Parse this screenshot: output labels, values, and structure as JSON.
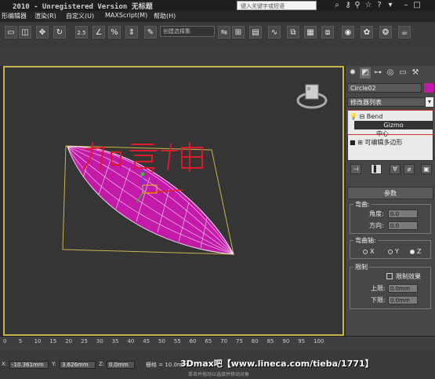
{
  "titlebar": {
    "title": "2010 - Unregistered Version  无标题",
    "search_placeholder": "键入关键字或短语",
    "icons": [
      "binoculars-icon",
      "star-icon",
      "key-icon",
      "question-icon",
      "minimize-icon",
      "maximize-icon"
    ]
  },
  "menu": {
    "items": [
      "形编辑器",
      "渲染(R)",
      "自定义(U)",
      "MAXScript(M)",
      "帮助(H)"
    ]
  },
  "toolbar": {
    "selection_set": "创建选择集",
    "percent_label": "%",
    "snap_label": "2.5",
    "buttons": [
      "select-region-icon",
      "move-icon",
      "rotate-icon",
      "window-crossing-icon",
      "snap-icon",
      "angle-snap-icon",
      "percent-snap-icon",
      "spinner-snap-icon",
      "edit-named-sel-icon",
      "mirror-icon",
      "align-icon",
      "layer-icon",
      "curve-editor-icon",
      "schematic-icon",
      "material-editor-icon",
      "render-setup-icon",
      "render-frame-icon",
      "render-icon",
      "teapot-icon"
    ]
  },
  "viewport": {
    "annotation": "加弯曲",
    "background": "#353535",
    "border_color": "#c9b34a",
    "object_color": "#c41aa9"
  },
  "command_panel": {
    "tabs": [
      "create-tab-icon",
      "modify-tab-icon",
      "hierarchy-tab-icon",
      "motion-tab-icon",
      "display-tab-icon",
      "utilities-tab-icon"
    ],
    "object_name": "Circle02",
    "object_color": "#c41aa9",
    "modifier_list": "修改器列表",
    "stack": {
      "bend": "Bend",
      "gizmo": "Gizmo",
      "center": "中心",
      "editable_poly": "可编辑多边形"
    },
    "rollout_title": "参数",
    "bend_group": {
      "label": "弯曲:",
      "angle_label": "角度:",
      "angle_value": "0.0",
      "direction_label": "方向:",
      "direction_value": "0.0"
    },
    "axis_group": {
      "label": "弯曲轴:",
      "x": "X",
      "y": "Y",
      "z": "Z",
      "selected": "Z"
    },
    "limit_group": {
      "label": "限制",
      "limit_effect": "限制效果",
      "upper_label": "上限:",
      "upper_value": "0.0mm",
      "lower_label": "下限:",
      "lower_value": "0.0mm"
    }
  },
  "timeline": {
    "ticks": [
      "0",
      "5",
      "10",
      "15",
      "20",
      "25",
      "30",
      "35",
      "40",
      "45",
      "50",
      "55",
      "60",
      "65",
      "70",
      "75",
      "80",
      "85",
      "90",
      "95",
      "100"
    ]
  },
  "status": {
    "x_label": "X:",
    "x_value": "-10.361mm",
    "y_label": "Y:",
    "y_value": "3.626mm",
    "z_label": "Z:",
    "z_value": "0.0mm",
    "grid_label": "栅格 = 10.0mm",
    "prompt": "单击并拖动以选择并移动对象",
    "watermark": "3Dmax吧【www.lineca.com/tieba/1771】"
  }
}
